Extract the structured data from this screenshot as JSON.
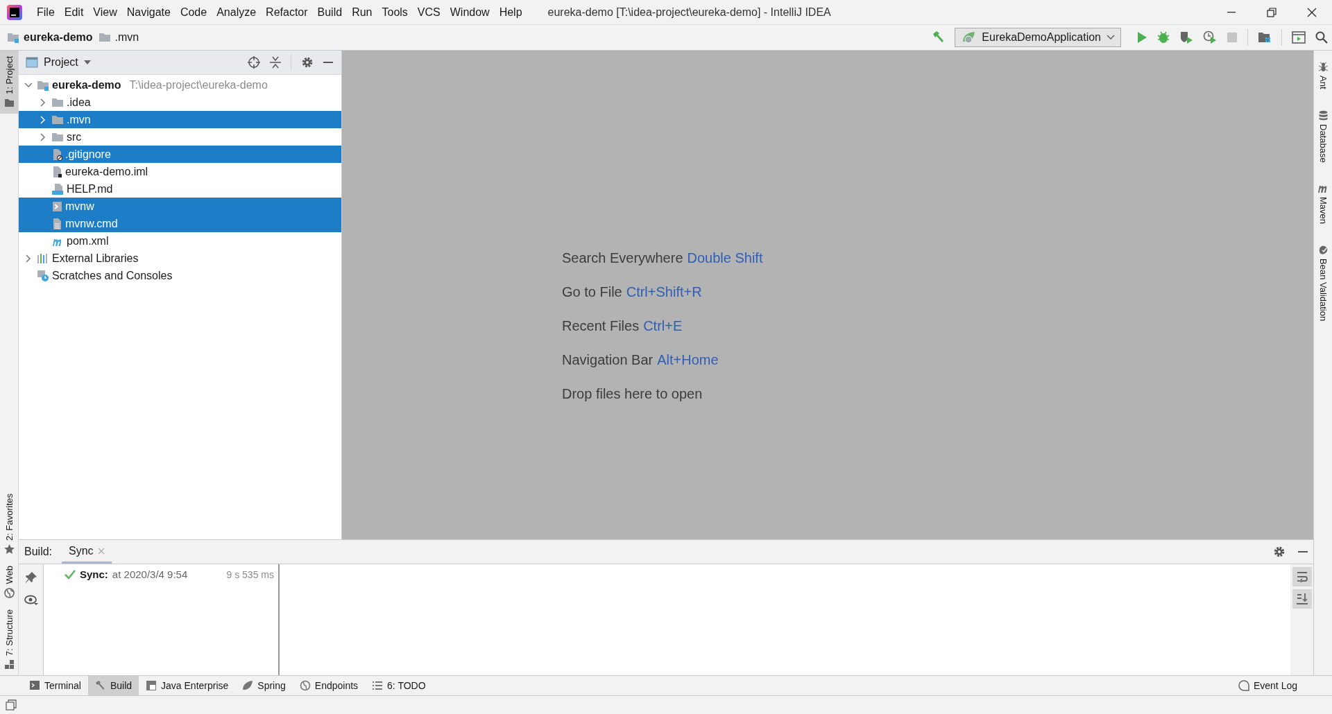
{
  "title_bar": {
    "menu": [
      "File",
      "Edit",
      "View",
      "Navigate",
      "Code",
      "Analyze",
      "Refactor",
      "Build",
      "Run",
      "Tools",
      "VCS",
      "Window",
      "Help"
    ],
    "window_title": "eureka-demo [T:\\idea-project\\eureka-demo] - IntelliJ IDEA"
  },
  "nav_bar": {
    "breadcrumbs": [
      {
        "label": "eureka-demo",
        "kind": "module"
      },
      {
        "label": ".mvn",
        "kind": "folder"
      }
    ],
    "run_configuration": "EurekaDemoApplication"
  },
  "left_strip": {
    "top_tabs": [
      {
        "label": "1: Project",
        "selected": true,
        "kind": "project"
      }
    ],
    "bottom_tabs": [
      {
        "label": "2: Favorites",
        "selected": false,
        "kind": "favorites"
      },
      {
        "label": "Web",
        "selected": false,
        "kind": "web"
      },
      {
        "label": "7: Structure",
        "selected": false,
        "kind": "structure"
      }
    ]
  },
  "project_panel": {
    "title": "Project",
    "tree": [
      {
        "label": "eureka-demo",
        "hint": "T:\\idea-project\\eureka-demo",
        "kind": "module",
        "expanded": true,
        "selected": false,
        "children": [
          {
            "label": ".idea",
            "kind": "folder",
            "expanded": false,
            "selected": false
          },
          {
            "label": ".mvn",
            "kind": "folder",
            "expanded": false,
            "selected": true
          },
          {
            "label": "src",
            "kind": "folder",
            "expanded": false,
            "selected": false
          },
          {
            "label": ".gitignore",
            "kind": "ignore",
            "selected": true
          },
          {
            "label": "eureka-demo.iml",
            "kind": "iml",
            "selected": false
          },
          {
            "label": "HELP.md",
            "kind": "markdown",
            "selected": false
          },
          {
            "label": "mvnw",
            "kind": "script",
            "selected": true
          },
          {
            "label": "mvnw.cmd",
            "kind": "text",
            "selected": true
          },
          {
            "label": "pom.xml",
            "kind": "maven",
            "selected": false
          }
        ]
      },
      {
        "label": "External Libraries",
        "kind": "libraries",
        "expanded": false,
        "selected": false
      },
      {
        "label": "Scratches and Consoles",
        "kind": "scratches",
        "selected": false
      }
    ]
  },
  "editor_hints": [
    {
      "text": "Search Everywhere",
      "shortcut": "Double Shift"
    },
    {
      "text": "Go to File",
      "shortcut": "Ctrl+Shift+R"
    },
    {
      "text": "Recent Files",
      "shortcut": "Ctrl+E"
    },
    {
      "text": "Navigation Bar",
      "shortcut": "Alt+Home"
    },
    {
      "text": "Drop files here to open"
    }
  ],
  "right_strip": {
    "tabs": [
      {
        "label": "Ant",
        "kind": "ant"
      },
      {
        "label": "Database",
        "kind": "database"
      },
      {
        "label": "Maven",
        "kind": "maven"
      },
      {
        "label": "Bean Validation",
        "kind": "bean"
      }
    ]
  },
  "build_panel": {
    "label": "Build:",
    "tabs": [
      {
        "label": "Sync",
        "selected": true
      }
    ],
    "entries": [
      {
        "title": "Sync:",
        "text": "at 2020/3/4 9:54",
        "duration": "9 s 535 ms"
      }
    ]
  },
  "tool_bar": {
    "tabs": [
      {
        "label": "Terminal",
        "kind": "terminal",
        "selected": false
      },
      {
        "label": "Build",
        "kind": "build",
        "selected": true
      },
      {
        "label": "Java Enterprise",
        "kind": "javaee",
        "selected": false
      },
      {
        "label": "Spring",
        "kind": "spring",
        "selected": false
      },
      {
        "label": "Endpoints",
        "kind": "endpoints",
        "selected": false
      },
      {
        "label": "6: TODO",
        "kind": "todo",
        "selected": false
      }
    ],
    "right": [
      {
        "label": "Event Log",
        "kind": "eventlog"
      }
    ]
  }
}
